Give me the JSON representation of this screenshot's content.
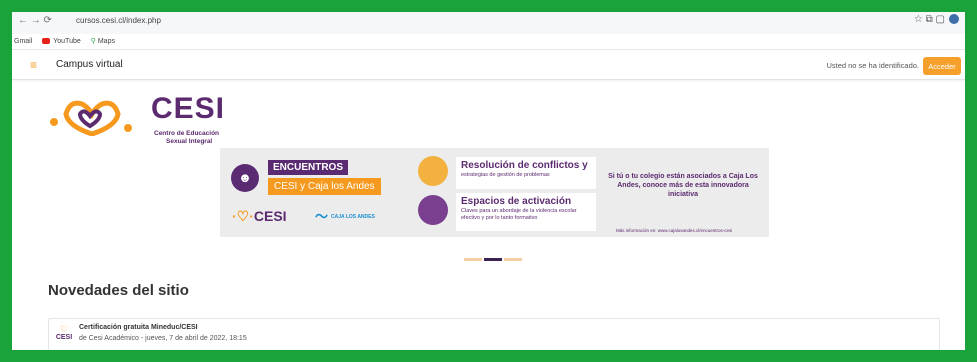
{
  "browser": {
    "url": "cursos.cesi.cl/index.php",
    "bookmarks": [
      "Gmail",
      "YouTube",
      "Maps"
    ]
  },
  "navbar": {
    "menu_icon": "hamburger-icon",
    "title": "Campus virtual",
    "login_status": "Usted no se ha identificado.",
    "login_button": "Acceder"
  },
  "logo": {
    "brand": "CESI",
    "sub_line1": "Centro de Educación",
    "sub_line2": "Sexual Integral"
  },
  "banner": {
    "encuentros_label": "ENCUENTROS",
    "encuentros_sub": "CESI y Caja los Andes",
    "cesi_logo": "CESI",
    "caja_logo": "CAJA LOS ANDES",
    "card1_title": "Resolución de conflictos y",
    "card1_sub": "estrategias de gestión de problemas",
    "card2_title": "Espacios de activación",
    "card2_sub": "Claves para un abordaje de la violencia escolar efectivo y por lo tanto formativo",
    "right_text": "Si tú o tu colegio están asociados a Caja Los Andes, conoce más de esta innovadora iniciativa",
    "more_info": "Más información en: www.cajalosandes.cl/encuentros-cesi"
  },
  "carousel": {
    "slide_count": 3,
    "active_index": 1
  },
  "news": {
    "heading": "Novedades del sitio",
    "posts": [
      {
        "title": "Certificación gratuita Mineduc/CESI",
        "meta": "de Cesi Académico - jueves, 7 de abril de 2022, 18:15"
      }
    ]
  },
  "colors": {
    "frame_green": "#19a33a",
    "brand_purple": "#5b2a6f",
    "accent_orange": "#f59a1f"
  }
}
